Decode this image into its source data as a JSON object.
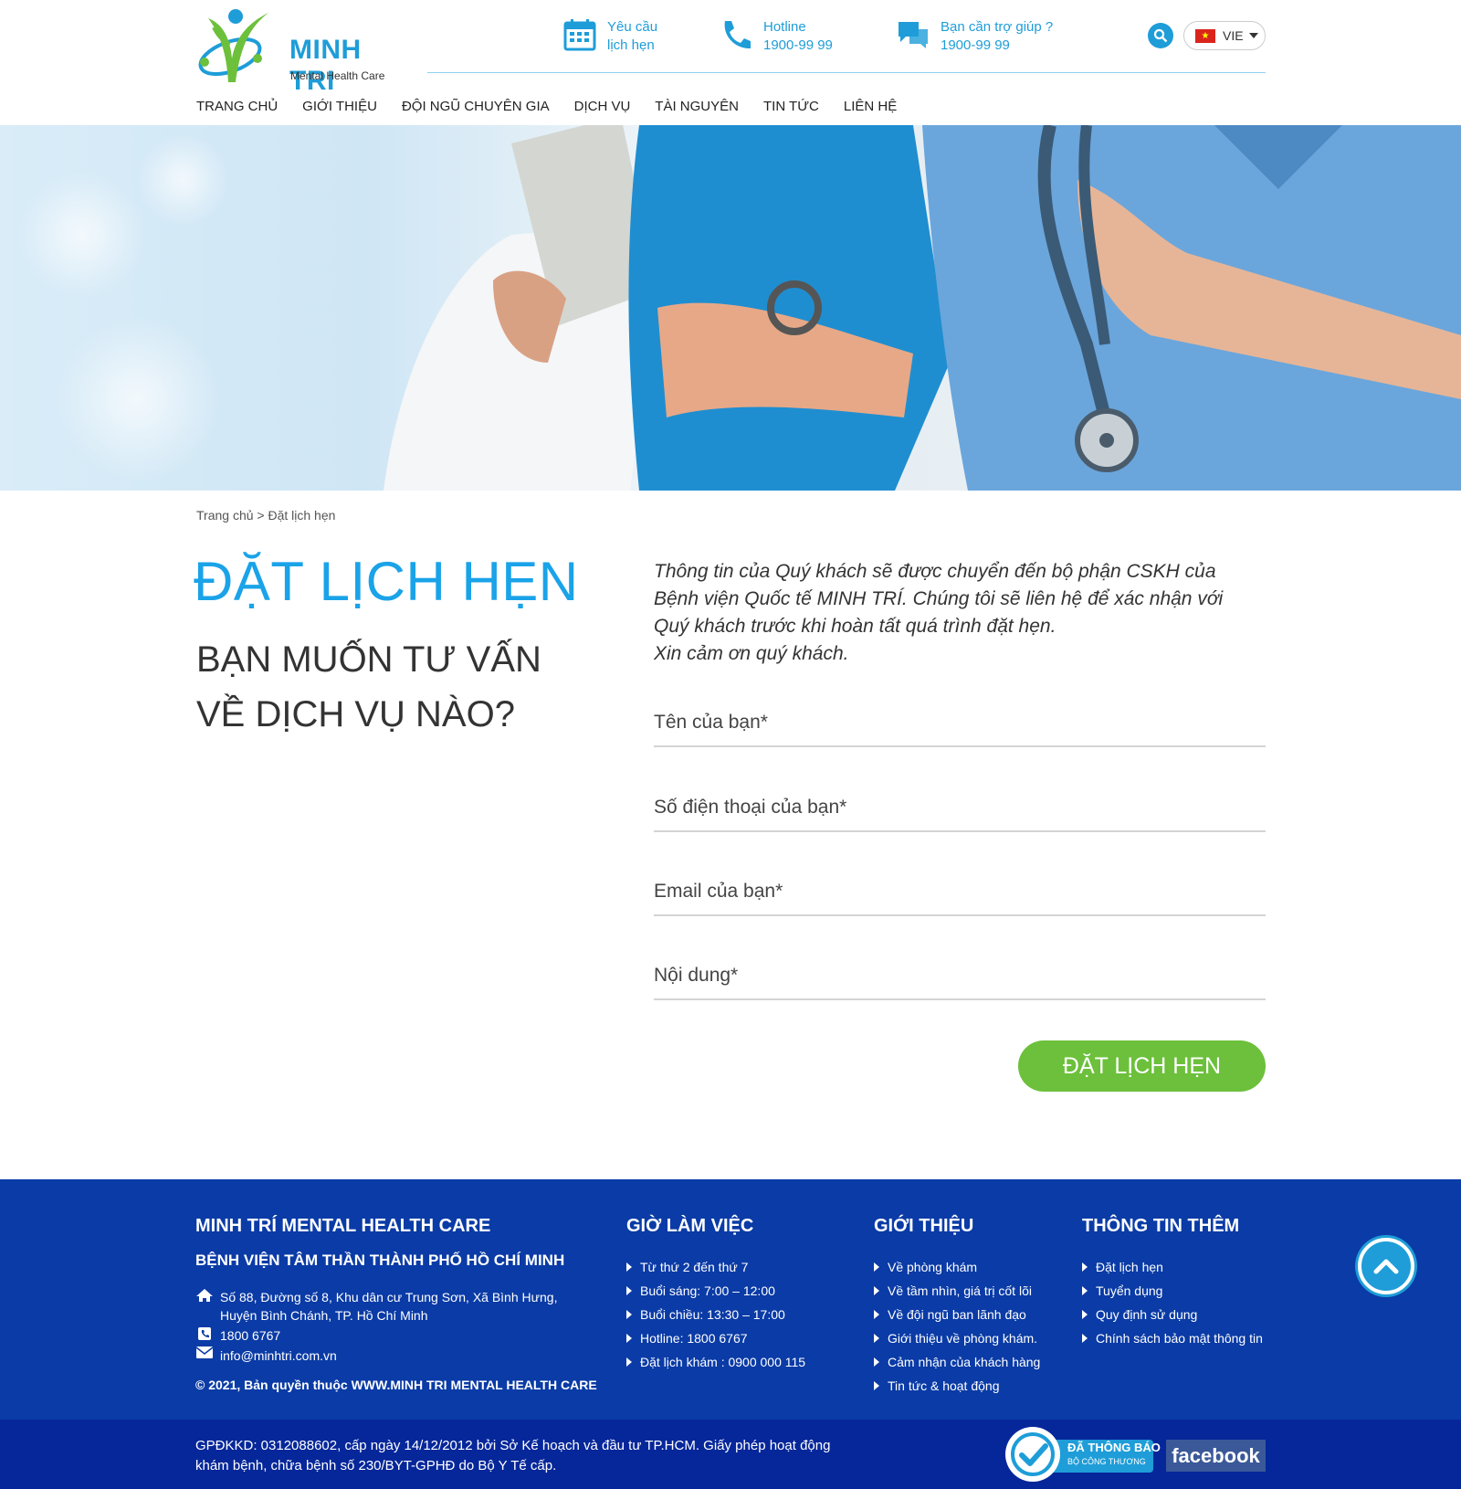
{
  "brand": {
    "name": "MINH TRI",
    "tagline": "Mental Health Care"
  },
  "header_info": [
    {
      "icon": "calendar-icon",
      "line1": "Yêu cầu",
      "line2": "lịch hẹn"
    },
    {
      "icon": "phone-icon",
      "line1": "Hotline",
      "line2": "1900-99 99"
    },
    {
      "icon": "chat-icon",
      "line1": "Bạn cần trợ giúp ?",
      "line2": "1900-99 99"
    }
  ],
  "language": {
    "selected": "VIE"
  },
  "nav": [
    "TRANG CHỦ",
    "GIỚI THIỆU",
    "ĐỘI NGŨ CHUYÊN GIA",
    "DỊCH VỤ",
    "TÀI NGUYÊN",
    "TIN TỨC",
    "LIÊN HỆ"
  ],
  "breadcrumb": "Trang chủ > Đặt lịch hẹn",
  "page": {
    "title": "ĐẶT LỊCH HẸN",
    "subtitle": "BẠN MUỐN TƯ VẤN VỀ DỊCH VỤ NÀO?"
  },
  "form": {
    "intro_lines": [
      "Thông tin của Quý khách sẽ được chuyển đến bộ phận CSKH của",
      "Bệnh viện Quốc tế MINH TRÍ. Chúng tôi sẽ liên hệ để xác nhận với",
      "Quý khách trước khi hoàn tất quá trình đặt hẹn.",
      "Xin cảm ơn quý khách."
    ],
    "name_placeholder": "Tên của bạn*",
    "phone_placeholder": "Số điện thoại của bạn*",
    "email_placeholder": "Email của bạn*",
    "content_placeholder": "Nội dung*",
    "submit_label": "ĐẶT LỊCH HẸN"
  },
  "footer": {
    "company": {
      "heading": "MINH TRÍ MENTAL HEALTH CARE",
      "subheading": "BỆNH VIỆN TÂM THẦN THÀNH PHỐ HỒ CHÍ MINH",
      "address_line1": "Số 88, Đường số 8, Khu dân cư Trung Sơn, Xã Bình Hưng,",
      "address_line2": "Huyện Bình Chánh, TP. Hồ Chí Minh",
      "phone": "1800 6767",
      "email": "info@minhtri.com.vn",
      "copyright": "© 2021, Bản quyền thuộc WWW.MINH TRI MENTAL HEALTH CARE"
    },
    "hours": {
      "heading": "GIỜ LÀM VIỆC",
      "items": [
        "Từ thứ 2 đến thứ 7",
        "Buổi sáng: 7:00 – 12:00",
        "Buổi chiều: 13:30 – 17:00",
        "Hotline: 1800 6767",
        "Đặt lịch khám : 0900 000 115"
      ]
    },
    "about": {
      "heading": "GIỚI THIỆU",
      "items": [
        "Về phòng khám",
        "Về tầm nhìn, giá trị cốt lõi",
        "Về đội ngũ ban lãnh đạo",
        "Giới thiệu về phòng khám.",
        "Cảm nhận của khách hàng",
        "Tin tức & hoạt động"
      ]
    },
    "more": {
      "heading": "THÔNG TIN THÊM",
      "items": [
        "Đặt lịch hẹn",
        "Tuyển dụng",
        "Quy định sử dụng",
        "Chính sách bảo mật thông tin"
      ]
    },
    "license_line1": "GPĐKKD: 0312088602, cấp ngày 14/12/2012 bởi Sở Kế hoạch và đầu tư TP.HCM. Giấy phép hoạt động",
    "license_line2": "khám bệnh, chữa bệnh số 230/BYT-GPHĐ do Bộ Y Tế cấp.",
    "badge_line1": "ĐÃ THÔNG BÁO",
    "badge_line2": "BỘ CÔNG THƯƠNG",
    "facebook": "facebook"
  },
  "colors": {
    "brand_blue": "#1e9dd8",
    "title_blue": "#1aa3e8",
    "green": "#6cc03b",
    "footer_bg": "#0a3ba6",
    "footer_bottom_bg": "#06279a"
  }
}
